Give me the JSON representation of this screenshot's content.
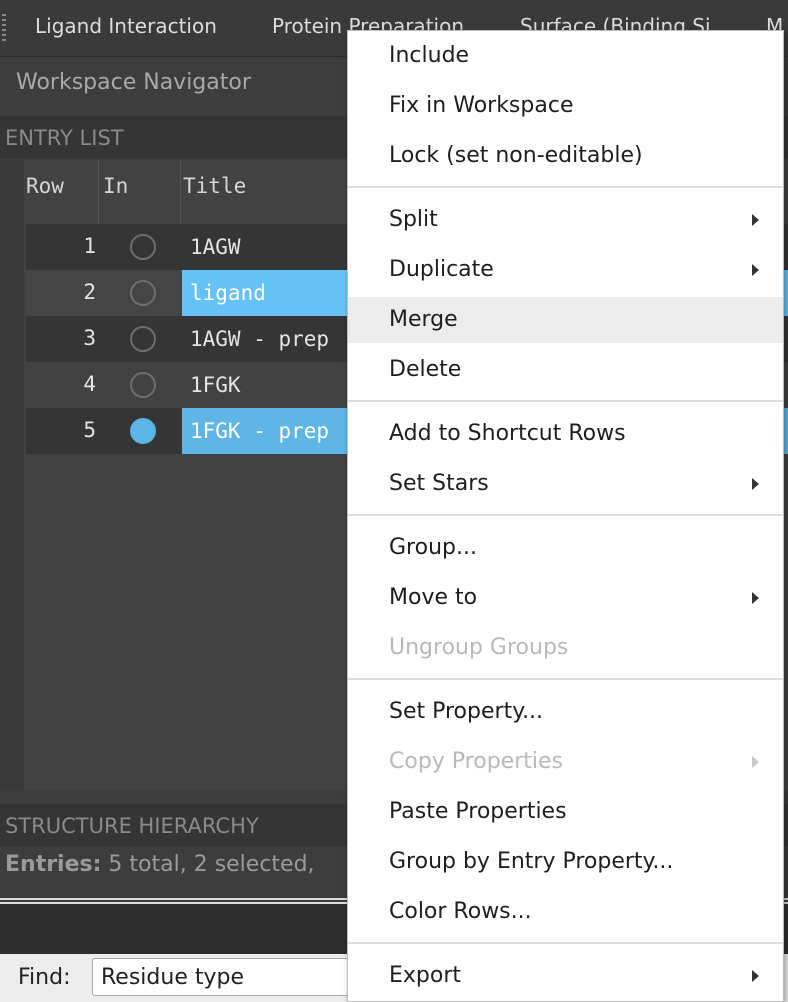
{
  "tabs": [
    {
      "label": "Ligand Interaction"
    },
    {
      "label": "Protein Preparation"
    },
    {
      "label": "Surface (Binding Si"
    },
    {
      "label": "M"
    }
  ],
  "navigator": {
    "title": "Workspace Navigator"
  },
  "entry_list": {
    "section_label": "ENTRY LIST",
    "columns": {
      "row": "Row",
      "in": "In",
      "title": "Title"
    },
    "rows": [
      {
        "row": "1",
        "included": false,
        "title": "1AGW"
      },
      {
        "row": "2",
        "included": false,
        "title": "ligand"
      },
      {
        "row": "3",
        "included": false,
        "title": "1AGW - prep"
      },
      {
        "row": "4",
        "included": false,
        "title": "1FGK"
      },
      {
        "row": "5",
        "included": true,
        "title": "1FGK - prep"
      }
    ]
  },
  "structure_hierarchy": {
    "section_label": "STRUCTURE HIERARCHY"
  },
  "status": {
    "entries_label": "Entries:",
    "entries_text": " 5 total, 2 selected,"
  },
  "find": {
    "label": "Find:",
    "value": "Residue type"
  },
  "context_menu": {
    "include": "Include",
    "fix": "Fix in Workspace",
    "lock": "Lock (set non-editable)",
    "split": "Split",
    "duplicate": "Duplicate",
    "merge": "Merge",
    "delete": "Delete",
    "add_shortcut": "Add to Shortcut Rows",
    "set_stars": "Set Stars",
    "group": "Group...",
    "move_to": "Move to",
    "ungroup": "Ungroup Groups",
    "set_property": "Set Property...",
    "copy_properties": "Copy Properties",
    "paste_properties": "Paste Properties",
    "group_by_property": "Group by Entry Property...",
    "color_rows": "Color Rows...",
    "export": "Export"
  },
  "colors": {
    "selection": "#5fb6e6",
    "included_dot": "#5cb3e8",
    "menu_hover": "#ececec"
  }
}
